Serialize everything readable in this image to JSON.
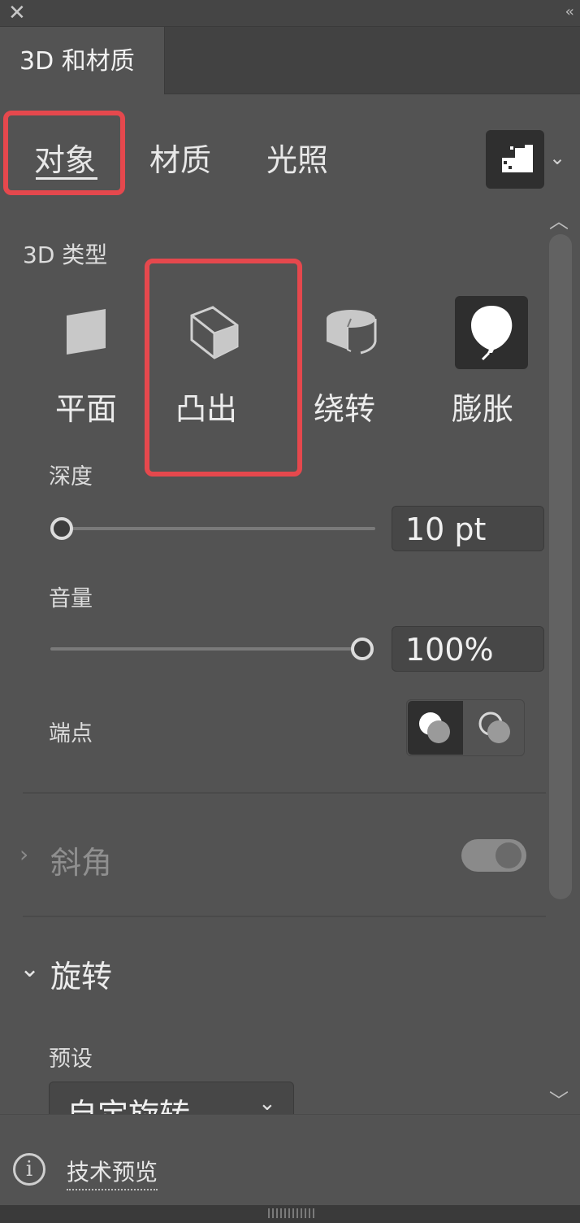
{
  "window": {
    "close_icon": "close-icon",
    "collapse_icon": "double-chevron-left-icon"
  },
  "panel": {
    "tab_title": "3D 和材质"
  },
  "segments": {
    "object": "对象",
    "material": "材质",
    "light": "光照",
    "active": "object",
    "render_icon": "render-icon",
    "render_caret_icon": "chevron-down-icon"
  },
  "object": {
    "type_title": "3D 类型",
    "types": [
      {
        "label": "平面",
        "icon": "plane-icon"
      },
      {
        "label": "凸出",
        "icon": "extrude-icon",
        "selected": true
      },
      {
        "label": "绕转",
        "icon": "revolve-icon"
      },
      {
        "label": "膨胀",
        "icon": "inflate-icon"
      }
    ],
    "depth": {
      "label": "深度",
      "value": "10 pt",
      "slider_fraction": 0.0
    },
    "volume": {
      "label": "音量",
      "value": "100%",
      "slider_fraction": 1.0
    },
    "cap": {
      "label": "端点",
      "on_icon": "cap-on-icon",
      "off_icon": "cap-off-icon",
      "selected": "on"
    },
    "bevel": {
      "label": "斜角",
      "enabled": false,
      "expanded": false
    },
    "rotation": {
      "label": "旋转",
      "expanded": true,
      "preset_label": "预设",
      "preset_value": "自定旋转"
    }
  },
  "footer": {
    "tech_preview": "技术预览",
    "info_icon": "info-icon",
    "info_glyph": "i"
  },
  "highlight_color": "#e5484d"
}
